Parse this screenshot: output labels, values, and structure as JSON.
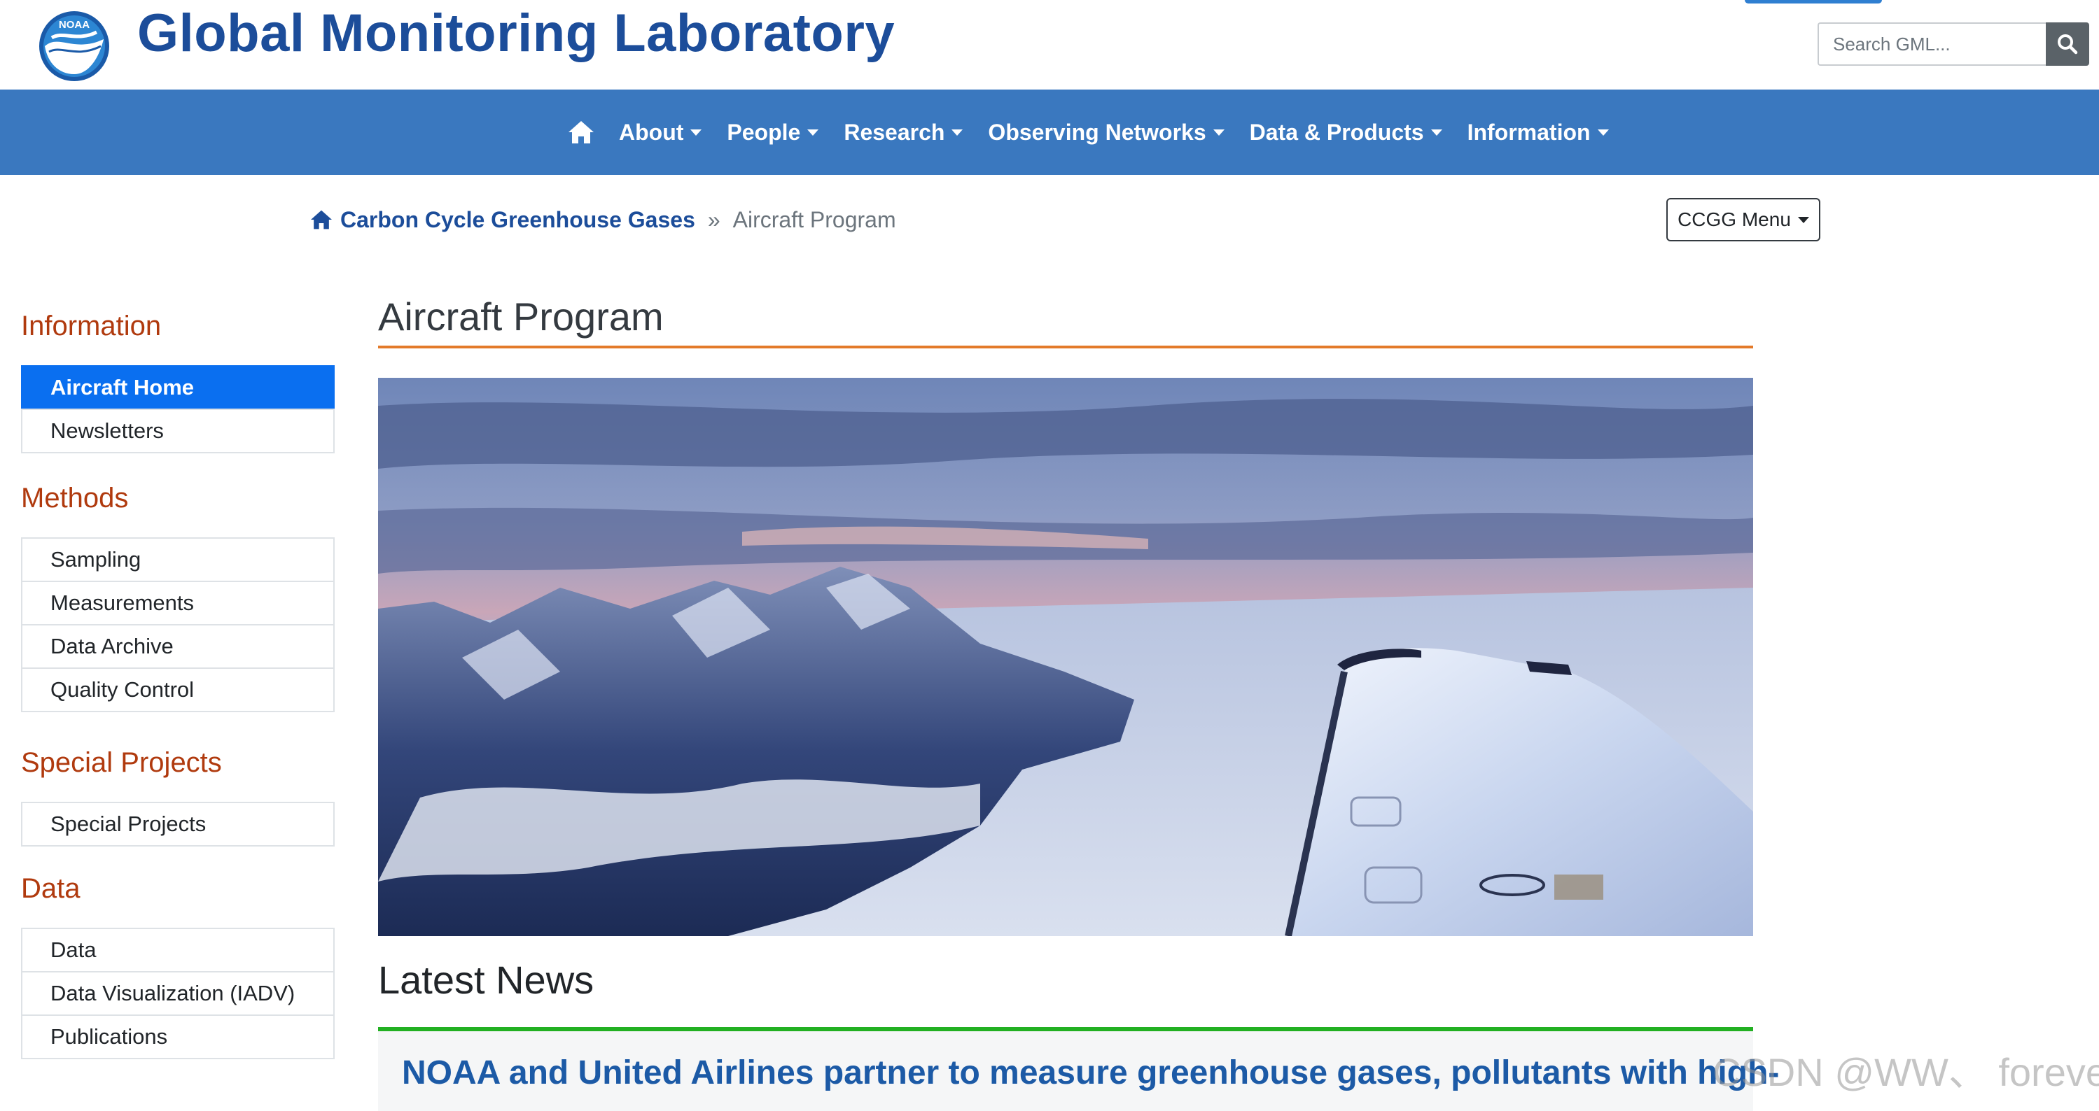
{
  "header": {
    "site_title": "Global Monitoring Laboratory",
    "logo_alt": "NOAA",
    "search_placeholder": "Search GML..."
  },
  "nav": {
    "items": [
      "About",
      "People",
      "Research",
      "Observing Networks",
      "Data & Products",
      "Information"
    ]
  },
  "breadcrumb": {
    "parent": "Carbon Cycle Greenhouse Gases",
    "separator": "»",
    "current": "Aircraft Program"
  },
  "ccgg_menu_label": "CCGG Menu",
  "sidebar": {
    "sections": [
      {
        "heading": "Information",
        "items": [
          "Aircraft Home",
          "Newsletters"
        ],
        "active_item": "Aircraft Home"
      },
      {
        "heading": "Methods",
        "items": [
          "Sampling",
          "Measurements",
          "Data Archive",
          "Quality Control"
        ]
      },
      {
        "heading": "Special Projects",
        "items": [
          "Special Projects"
        ]
      },
      {
        "heading": "Data",
        "items": [
          "Data",
          "Data Visualization (IADV)",
          "Publications"
        ]
      }
    ]
  },
  "main": {
    "page_title": "Aircraft Program",
    "latest_news_heading": "Latest News",
    "news_title": "NOAA and United Airlines partner to measure greenhouse gases, pollutants with high-"
  },
  "watermark": "CSDN @WW、 forever",
  "colors": {
    "brand_blue": "#1c4d9a",
    "nav_blue": "#3a78bf",
    "active_blue": "#0a6ff0",
    "section_heading": "#b03a0e",
    "title_rule": "#e37a2a",
    "news_rule": "#22b022"
  }
}
